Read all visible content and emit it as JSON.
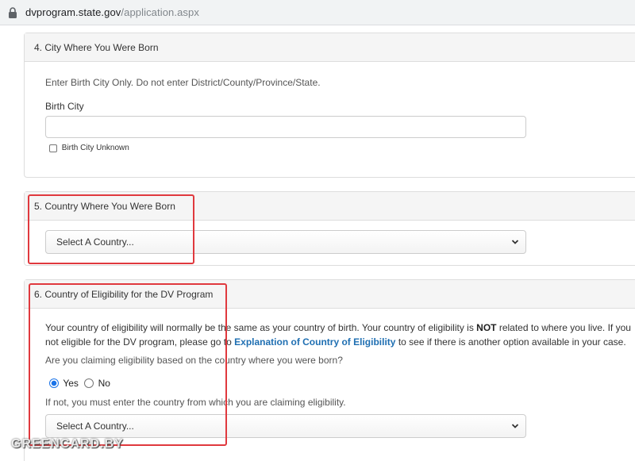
{
  "browser": {
    "url_domain": "dvprogram.state.gov",
    "url_path": "/application.aspx"
  },
  "section4": {
    "heading": "4. City Where You Were Born",
    "help": "Enter Birth City Only. Do not enter District/County/Province/State.",
    "field_label": "Birth City",
    "input_value": "",
    "checkbox_label": "Birth City Unknown"
  },
  "section5": {
    "heading": "5. Country Where You Were Born",
    "select_value": "Select A Country..."
  },
  "section6": {
    "heading": "6. Country of Eligibility for the DV Program",
    "para_line1_a": "Your country of eligibility will normally be the same as your country of birth. Your country of eligibility is ",
    "para_line1_bold": "NOT",
    "para_line1_b": " related to where you live. If you",
    "para_line2_a": "not eligible for the DV program, please go to ",
    "para_line2_link": "Explanation of Country of Eligibility",
    "para_line2_b": " to see if there is another option available in your case.",
    "question": "Are you claiming eligibility based on the country where you were born?",
    "radio_yes": "Yes",
    "radio_no": "No",
    "selected": "Yes",
    "if_not": "If not, you must enter the country from which you are claiming eligibility.",
    "select_value": "Select A Country..."
  },
  "watermark": "GREENCARD.BY",
  "colors": {
    "highlight": "#e0393e",
    "link": "#1f6fb2"
  }
}
